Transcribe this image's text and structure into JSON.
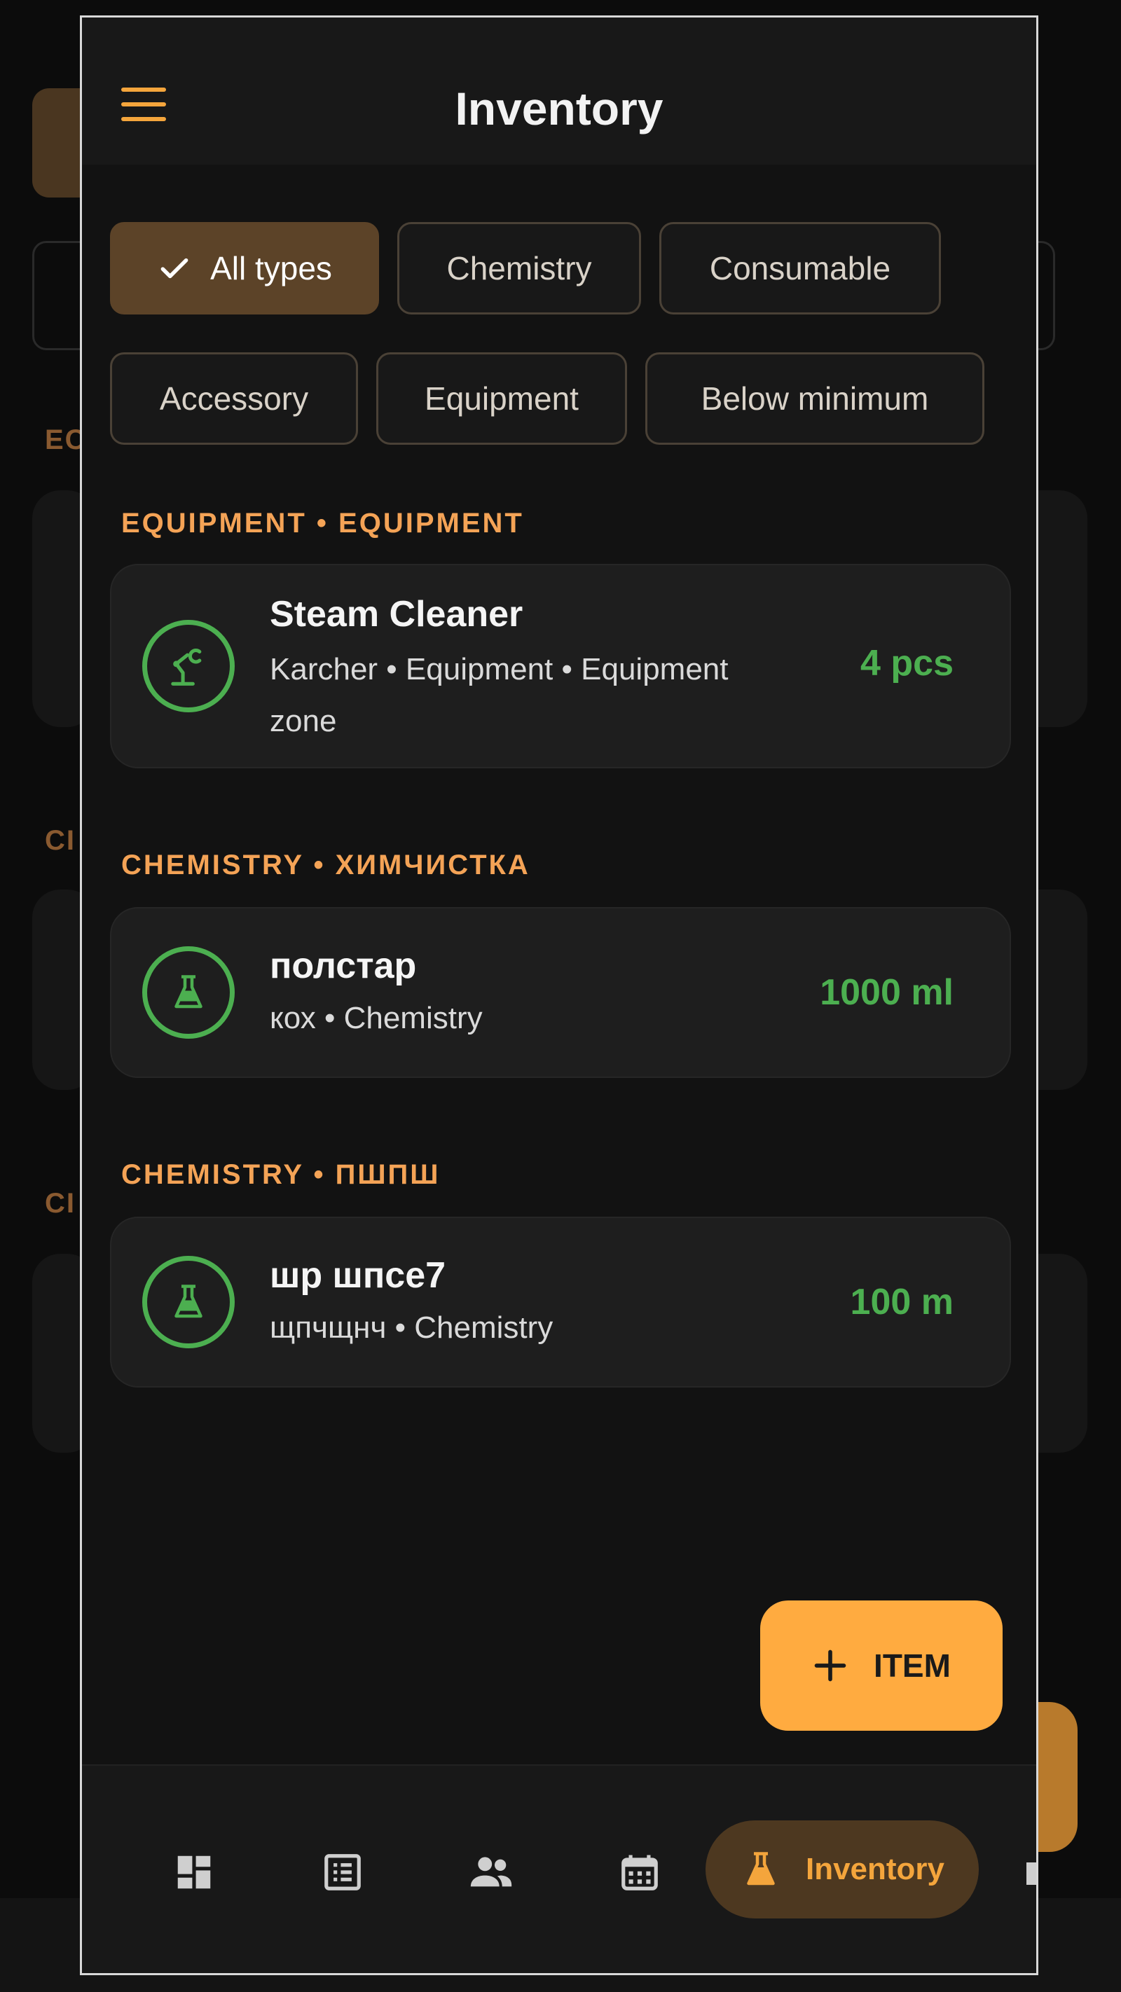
{
  "app": {
    "title": "Inventory"
  },
  "filters": [
    {
      "label": "All types",
      "selected": true
    },
    {
      "label": "Chemistry",
      "selected": false
    },
    {
      "label": "Consumable",
      "selected": false
    },
    {
      "label": "Accessory",
      "selected": false
    },
    {
      "label": "Equipment",
      "selected": false
    },
    {
      "label": "Below minimum",
      "selected": false
    }
  ],
  "sections": [
    {
      "label": "EQUIPMENT • EQUIPMENT",
      "item": {
        "icon": "robot-arm-icon",
        "name": "Steam Cleaner",
        "subtitle_line1": "Karcher • Equipment • Equipment",
        "subtitle_line2": "zone",
        "quantity": "4 pcs"
      }
    },
    {
      "label": "CHEMISTRY • ХИМЧИСТКА",
      "item": {
        "icon": "flask-icon",
        "name": "полстар",
        "subtitle_line1": "кох • Chemistry",
        "quantity": "1000 ml"
      }
    },
    {
      "label": "CHEMISTRY • ПШПШ",
      "item": {
        "icon": "flask-icon",
        "name": "шр шпсе7",
        "subtitle_line1": "щпчщнч • Chemistry",
        "quantity": "100 m"
      }
    }
  ],
  "fab": {
    "label": "ITEM",
    "icon": "plus-icon"
  },
  "bottom_nav": {
    "items": [
      {
        "icon": "dashboard-icon"
      },
      {
        "icon": "list-icon"
      },
      {
        "icon": "people-icon"
      },
      {
        "icon": "calendar-icon"
      },
      {
        "icon": "flask-icon",
        "label": "Inventory",
        "active": true
      }
    ]
  },
  "colors": {
    "accent": "#f4a53c",
    "fab": "#ffab40",
    "quantity_green": "#4caf50",
    "background": "#121212",
    "card": "#1e1e1e"
  }
}
